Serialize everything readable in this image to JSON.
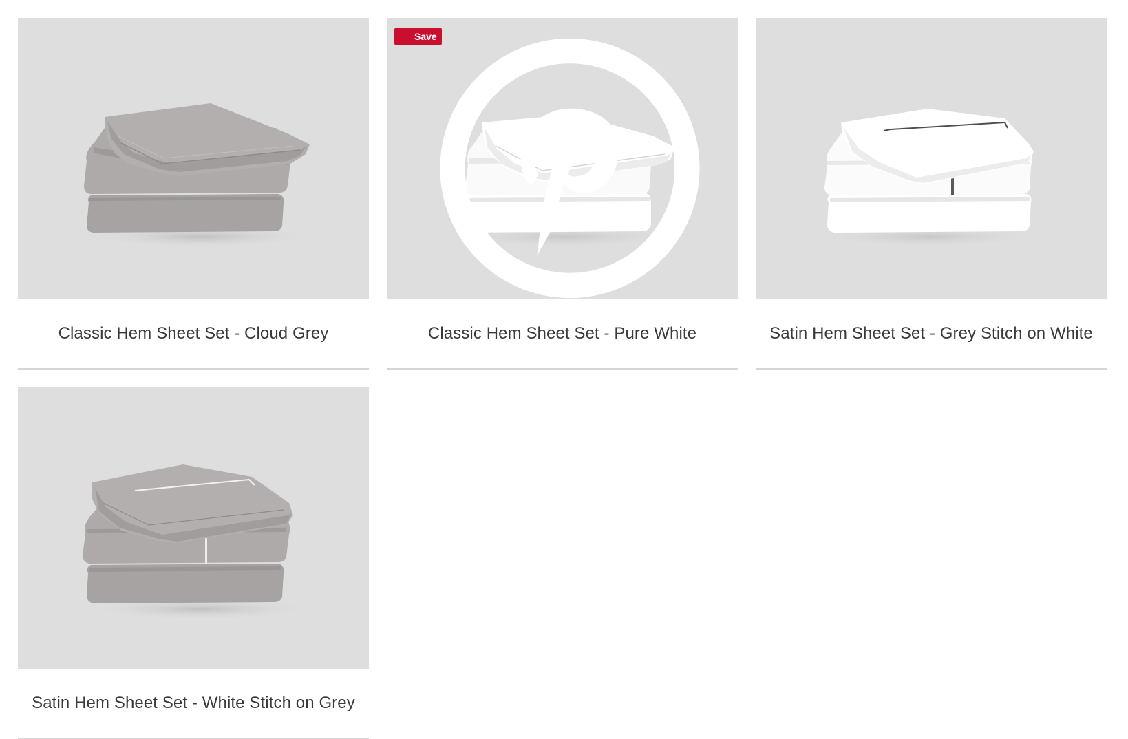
{
  "pinterest": {
    "save_label": "Save",
    "icon": "pinterest-icon",
    "color": "#c8102e"
  },
  "products": [
    {
      "title": "Classic Hem Sheet Set - Cloud Grey",
      "image": "folded-sheet-stack",
      "fabric_color": "#a9a5a5",
      "stitch_color": ""
    },
    {
      "title": "Classic Hem Sheet Set - Pure White",
      "image": "folded-sheet-stack",
      "fabric_color": "#ffffff",
      "stitch_color": ""
    },
    {
      "title": "Satin Hem Sheet Set - Grey Stitch on White",
      "image": "folded-sheet-stack",
      "fabric_color": "#ffffff",
      "stitch_color": "#555555"
    },
    {
      "title": "Satin Hem Sheet Set - White Stitch on Grey",
      "image": "folded-sheet-stack",
      "fabric_color": "#a9a5a5",
      "stitch_color": "#ececec"
    }
  ],
  "colors": {
    "image_background": "#dedede",
    "title_text": "#3a3a3a",
    "divider": "#d6d6d6"
  }
}
